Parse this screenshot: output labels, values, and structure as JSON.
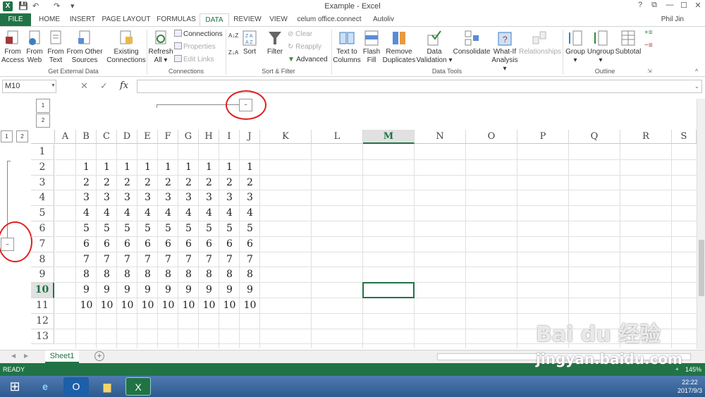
{
  "titlebar": {
    "title": "Example - Excel",
    "app_icon": "X",
    "help": "?",
    "restore": "⧉",
    "minimize": "—",
    "maximize": "☐",
    "close": "✕"
  },
  "tabs": [
    "FILE",
    "HOME",
    "INSERT",
    "PAGE LAYOUT",
    "FORMULAS",
    "DATA",
    "REVIEW",
    "VIEW",
    "celum office.connect",
    "Autoliv"
  ],
  "user": "Phil Jin",
  "ribbon": {
    "get_external": {
      "label": "Get External Data",
      "access": [
        "From",
        "Access"
      ],
      "web": [
        "From",
        "Web"
      ],
      "text": [
        "From",
        "Text"
      ],
      "other": [
        "From Other",
        "Sources"
      ],
      "existing": [
        "Existing",
        "Connections"
      ]
    },
    "connections": {
      "label": "Connections",
      "refresh": [
        "Refresh",
        "All"
      ],
      "conn": "Connections",
      "props": "Properties",
      "edit": "Edit Links"
    },
    "sort_filter": {
      "label": "Sort & Filter",
      "az": "A↓Z",
      "za": "Z↓A",
      "sort": "Sort",
      "filter": "Filter",
      "clear": "Clear",
      "reapply": "Reapply",
      "advanced": "Advanced"
    },
    "data_tools": {
      "label": "Data Tools",
      "t2c": [
        "Text to",
        "Columns"
      ],
      "flash": [
        "Flash",
        "Fill"
      ],
      "remove": [
        "Remove",
        "Duplicates"
      ],
      "valid": [
        "Data",
        "Validation"
      ],
      "consol": "Consolidate",
      "whatif": [
        "What-If",
        "Analysis"
      ],
      "rel": "Relationships"
    },
    "outline": {
      "label": "Outline",
      "group": "Group",
      "ungroup": "Ungroup",
      "subtotal": "Subtotal"
    }
  },
  "formula_bar": {
    "name_box": "M10",
    "cancel": "✕",
    "enter": "✓",
    "fx": "fx",
    "value": ""
  },
  "outline": {
    "level1": "1",
    "level2": "2",
    "collapse": "−"
  },
  "columns": [
    "A",
    "B",
    "C",
    "D",
    "E",
    "F",
    "G",
    "H",
    "I",
    "J",
    "K",
    "L",
    "M",
    "N",
    "O",
    "P",
    "Q",
    "R",
    "S"
  ],
  "rows": [
    "1",
    "2",
    "3",
    "4",
    "5",
    "6",
    "7",
    "8",
    "9",
    "10",
    "11",
    "12",
    "13"
  ],
  "cells": [
    [
      "",
      "",
      "",
      "",
      "",
      "",
      "",
      "",
      ""
    ],
    [
      "1",
      "1",
      "1",
      "1",
      "1",
      "1",
      "1",
      "1",
      "1"
    ],
    [
      "2",
      "2",
      "2",
      "2",
      "2",
      "2",
      "2",
      "2",
      "2"
    ],
    [
      "3",
      "3",
      "3",
      "3",
      "3",
      "3",
      "3",
      "3",
      "3"
    ],
    [
      "4",
      "4",
      "4",
      "4",
      "4",
      "4",
      "4",
      "4",
      "4"
    ],
    [
      "5",
      "5",
      "5",
      "5",
      "5",
      "5",
      "5",
      "5",
      "5"
    ],
    [
      "6",
      "6",
      "6",
      "6",
      "6",
      "6",
      "6",
      "6",
      "6"
    ],
    [
      "7",
      "7",
      "7",
      "7",
      "7",
      "7",
      "7",
      "7",
      "7"
    ],
    [
      "8",
      "8",
      "8",
      "8",
      "8",
      "8",
      "8",
      "8",
      "8"
    ],
    [
      "9",
      "9",
      "9",
      "9",
      "9",
      "9",
      "9",
      "9",
      "9"
    ],
    [
      "10",
      "10",
      "10",
      "10",
      "10",
      "10",
      "10",
      "10",
      "10"
    ],
    [
      "",
      "",
      "",
      "",
      "",
      "",
      "",
      "",
      ""
    ],
    [
      "",
      "",
      "",
      "",
      "",
      "",
      "",
      "",
      ""
    ]
  ],
  "sheet": {
    "name": "Sheet1",
    "add": "+"
  },
  "status": {
    "text": "READY",
    "zoom": "145%"
  },
  "taskbar": {
    "time": "22:22",
    "date": "2017/9/3"
  },
  "watermark": {
    "line1": "Bai du 经验",
    "line2": "jingyan.baidu.com"
  },
  "colors": {
    "excel_green": "#217346",
    "highlight_circle": "#e02020"
  }
}
